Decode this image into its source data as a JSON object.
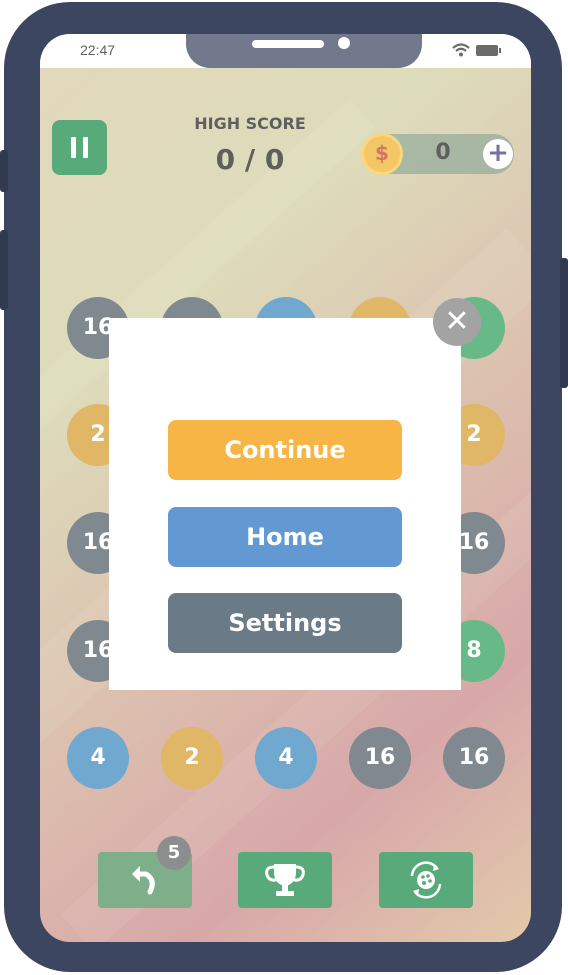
{
  "status_bar": {
    "time": "22:47"
  },
  "header": {
    "high_score_label": "HIGH SCORE",
    "score_value": "0 / 0",
    "coin_symbol": "$",
    "coin_count": "0",
    "add_coins_symbol": "+"
  },
  "board": {
    "rows": [
      [
        "16",
        "",
        "",
        "",
        ""
      ],
      [
        "2",
        "",
        "",
        "",
        "2"
      ],
      [
        "16",
        "",
        "",
        "",
        "16"
      ],
      [
        "16",
        "",
        "",
        "",
        "8"
      ],
      [
        "4",
        "2",
        "4",
        "16",
        "16"
      ]
    ]
  },
  "toolbar": {
    "undo_count": "5"
  },
  "pause_menu": {
    "close_symbol": "✕",
    "continue_label": "Continue",
    "home_label": "Home",
    "settings_label": "Settings"
  },
  "colors": {
    "continue": "#f6b544",
    "home": "#6399d2",
    "settings": "#6b7a87",
    "tile_16": "#4f5c66",
    "tile_2": "#d39b2c",
    "tile_4": "#3987bd",
    "tile_8": "#2f9f5a",
    "action_green": "#1a8a48"
  },
  "icons": [
    "pause-icon",
    "coin-icon",
    "plus-icon",
    "undo-icon",
    "trophy-icon",
    "palette-icon",
    "close-icon",
    "wifi-icon",
    "battery-icon"
  ]
}
